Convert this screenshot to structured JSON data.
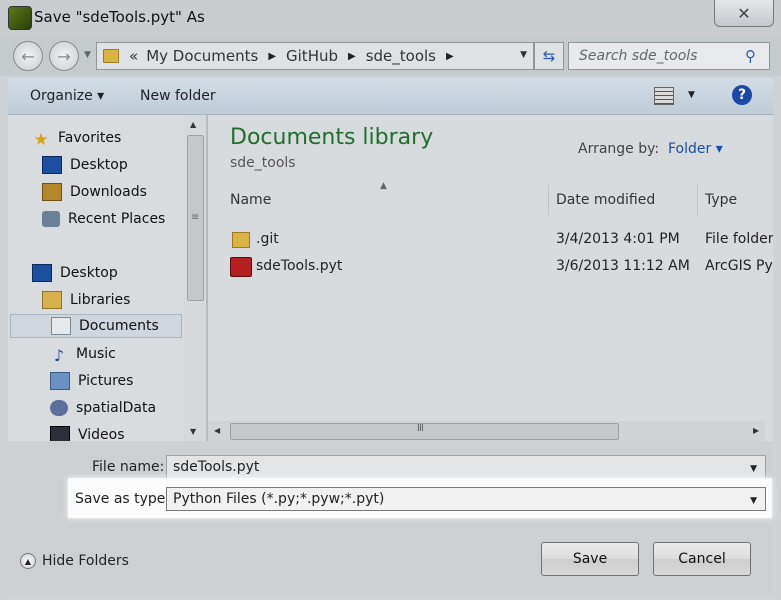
{
  "window": {
    "title": "Save \"sdeTools.pyt\" As",
    "close_glyph": "✕"
  },
  "nav": {
    "back_glyph": "←",
    "forward_glyph": "→",
    "breadcrumb_prefix": "«",
    "breadcrumbs": [
      "My Documents",
      "GitHub",
      "sde_tools"
    ],
    "refresh_glyph": "⇆",
    "search_placeholder": "Search sde_tools",
    "search_glyph": "⚲"
  },
  "toolbar": {
    "organize_label": "Organize ▾",
    "new_folder_label": "New folder",
    "help_glyph": "?"
  },
  "sidebar": {
    "items": [
      {
        "label": "Favorites",
        "icon": "star-icon"
      },
      {
        "label": "Desktop",
        "icon": "desktop-icon"
      },
      {
        "label": "Downloads",
        "icon": "downloads-icon"
      },
      {
        "label": "Recent Places",
        "icon": "recent-places-icon"
      },
      {
        "label": "Desktop",
        "icon": "desktop-icon"
      },
      {
        "label": "Libraries",
        "icon": "libraries-icon"
      },
      {
        "label": "Documents",
        "icon": "documents-icon",
        "selected": true
      },
      {
        "label": "Music",
        "icon": "music-icon"
      },
      {
        "label": "Pictures",
        "icon": "pictures-icon"
      },
      {
        "label": "spatialData",
        "icon": "spatial-data-icon"
      },
      {
        "label": "Videos",
        "icon": "videos-icon"
      }
    ]
  },
  "library": {
    "title": "Documents library",
    "subtitle": "sde_tools",
    "arrange_label": "Arrange by:",
    "arrange_value": "Folder ▾"
  },
  "columns": {
    "name": "Name",
    "date_modified": "Date modified",
    "type": "Type"
  },
  "files": [
    {
      "name": ".git",
      "date": "3/4/2013 4:01 PM",
      "type": "File folder"
    },
    {
      "name": "sdeTools.pyt",
      "date": "3/6/2013 11:12 AM",
      "type": "ArcGIS Pyt"
    }
  ],
  "form": {
    "file_name_label": "File name:",
    "file_name_value": "sdeTools.pyt",
    "save_type_label": "Save as type:",
    "save_type_value": "Python Files (*.py;*.pyw;*.pyt)"
  },
  "footer": {
    "hide_folders_label": "Hide Folders",
    "save_label": "Save",
    "cancel_label": "Cancel"
  }
}
